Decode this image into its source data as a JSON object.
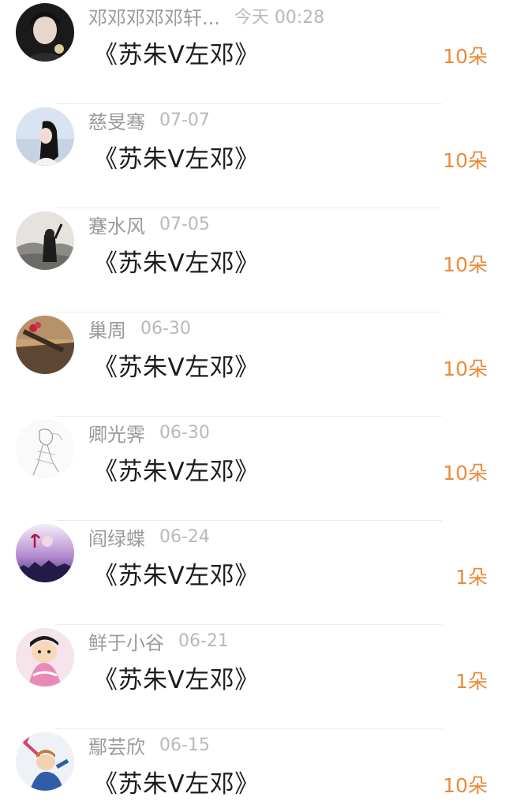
{
  "records": [
    {
      "name": "邓邓邓邓邓轩...",
      "date": "今天 00:28",
      "work": "《苏朱V左邓》",
      "flowers": "10朵",
      "avatar": "avatar-dark-portrait"
    },
    {
      "name": "慈旻骞",
      "date": "07-07",
      "work": "《苏朱V左邓》",
      "flowers": "10朵",
      "avatar": "avatar-girl-sky"
    },
    {
      "name": "蹇水风",
      "date": "07-05",
      "work": "《苏朱V左邓》",
      "flowers": "10朵",
      "avatar": "avatar-mountain-silhouette"
    },
    {
      "name": "巢周",
      "date": "06-30",
      "work": "《苏朱V左邓》",
      "flowers": "10朵",
      "avatar": "avatar-sunset-rose"
    },
    {
      "name": "卿光霁",
      "date": "06-30",
      "work": "《苏朱V左邓》",
      "flowers": "10朵",
      "avatar": "avatar-sketch-figure"
    },
    {
      "name": "阎绿蝶",
      "date": "06-24",
      "work": "《苏朱V左邓》",
      "flowers": "1朵",
      "avatar": "avatar-purple-city"
    },
    {
      "name": "鲜于小谷",
      "date": "06-21",
      "work": "《苏朱V左邓》",
      "flowers": "1朵",
      "avatar": "avatar-cartoon-pink"
    },
    {
      "name": "鄢芸欣",
      "date": "06-15",
      "work": "《苏朱V左邓》",
      "flowers": "10朵",
      "avatar": "avatar-anime-blue"
    }
  ],
  "colors": {
    "name": "#9a9a9a",
    "date": "#b9b9b9",
    "work": "#1c1c1c",
    "flowers": "#ea8a3a"
  }
}
